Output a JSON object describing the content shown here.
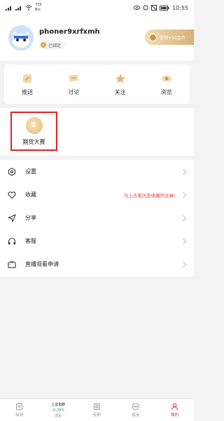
{
  "status_bar": {
    "net_speed_value": "725",
    "net_speed_unit": "B/s",
    "time": "10:55"
  },
  "profile": {
    "username": "phoner9xrfxmh",
    "bound_label": "已绑定",
    "signin_label": "签到+50金币"
  },
  "quick_nav": {
    "items": [
      {
        "label": "推送",
        "icon": "push-icon"
      },
      {
        "label": "讨论",
        "icon": "discussion-icon"
      },
      {
        "label": "关注",
        "icon": "star-icon"
      },
      {
        "label": "浏览",
        "icon": "eye-icon"
      }
    ]
  },
  "features": {
    "futures_label": "期货大赛"
  },
  "menu": {
    "items": [
      {
        "label": "设置",
        "icon": "settings-icon",
        "hint": ""
      },
      {
        "label": "收藏",
        "icon": "heart-icon",
        "hint": "马上去看历史收藏的文章!"
      },
      {
        "label": "分享",
        "icon": "share-icon",
        "hint": ""
      },
      {
        "label": "客服",
        "icon": "headset-icon",
        "hint": ""
      },
      {
        "label": "直播观看申请",
        "icon": "tv-icon",
        "hint": ""
      }
    ]
  },
  "bottom_nav": {
    "index_name": "上证指数",
    "index_change": "-0.29%",
    "tabs": [
      {
        "label": "新闻",
        "icon": "news-icon"
      },
      {
        "label": "选股",
        "icon": "index-icon"
      },
      {
        "label": "投顾",
        "icon": "advisor-icon"
      },
      {
        "label": "基金",
        "icon": "fund-icon"
      },
      {
        "label": "我的",
        "icon": "profile-icon"
      }
    ]
  },
  "colors": {
    "accent_red": "#e02424",
    "gold": "#d6b07a",
    "index_green": "#1aa34a"
  }
}
